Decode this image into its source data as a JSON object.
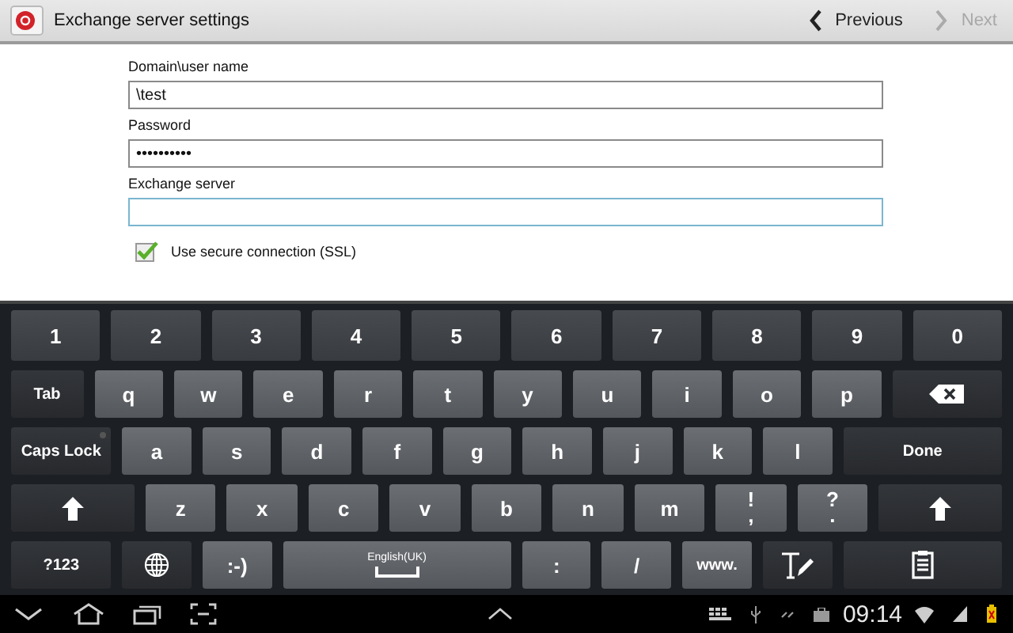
{
  "header": {
    "title": "Exchange server settings",
    "previous": "Previous",
    "next": "Next",
    "next_disabled": true
  },
  "form": {
    "fields": [
      {
        "label": "Domain\\user name",
        "value": "\\test",
        "focused": false
      },
      {
        "label": "Password",
        "value": "••••••••••",
        "focused": false
      },
      {
        "label": "Exchange server",
        "focused": true
      }
    ],
    "checkbox": {
      "label": "Use secure connection (SSL)",
      "checked": true
    }
  },
  "keyboard": {
    "rows": [
      [
        {
          "kind": "num",
          "label": "1"
        },
        {
          "kind": "num",
          "label": "2"
        },
        {
          "kind": "num",
          "label": "3"
        },
        {
          "kind": "num",
          "label": "4"
        },
        {
          "kind": "num",
          "label": "5"
        },
        {
          "kind": "num",
          "label": "6"
        },
        {
          "kind": "num",
          "label": "7"
        },
        {
          "kind": "num",
          "label": "8"
        },
        {
          "kind": "num",
          "label": "9"
        },
        {
          "kind": "num",
          "label": "0"
        }
      ],
      [
        {
          "kind": "tab",
          "label": "Tab"
        },
        {
          "kind": "letter",
          "label": "q"
        },
        {
          "kind": "letter",
          "label": "w"
        },
        {
          "kind": "letter",
          "label": "e"
        },
        {
          "kind": "letter",
          "label": "r"
        },
        {
          "kind": "letter",
          "label": "t"
        },
        {
          "kind": "letter",
          "label": "y"
        },
        {
          "kind": "letter",
          "label": "u"
        },
        {
          "kind": "letter",
          "label": "i"
        },
        {
          "kind": "letter",
          "label": "o"
        },
        {
          "kind": "letter",
          "label": "p"
        },
        {
          "kind": "backspace"
        }
      ],
      [
        {
          "kind": "caps",
          "label": "Caps Lock",
          "on": false
        },
        {
          "kind": "letter",
          "label": "a"
        },
        {
          "kind": "letter",
          "label": "s"
        },
        {
          "kind": "letter",
          "label": "d"
        },
        {
          "kind": "letter",
          "label": "f"
        },
        {
          "kind": "letter",
          "label": "g"
        },
        {
          "kind": "letter",
          "label": "h"
        },
        {
          "kind": "letter",
          "label": "j"
        },
        {
          "kind": "letter",
          "label": "k"
        },
        {
          "kind": "letter",
          "label": "l"
        },
        {
          "kind": "done",
          "label": "Done"
        }
      ],
      [
        {
          "kind": "shift"
        },
        {
          "kind": "letter",
          "label": "z"
        },
        {
          "kind": "letter",
          "label": "x"
        },
        {
          "kind": "letter",
          "label": "c"
        },
        {
          "kind": "letter",
          "label": "v"
        },
        {
          "kind": "letter",
          "label": "b"
        },
        {
          "kind": "letter",
          "label": "n"
        },
        {
          "kind": "letter",
          "label": "m"
        },
        {
          "kind": "punct",
          "label": "!",
          "sub": ","
        },
        {
          "kind": "punct",
          "label": "?",
          "sub": "."
        },
        {
          "kind": "shift"
        }
      ],
      [
        {
          "kind": "symbols",
          "label": "?123"
        },
        {
          "kind": "globe"
        },
        {
          "kind": "letter",
          "label": ":-)"
        },
        {
          "kind": "space",
          "label": "English(UK)"
        },
        {
          "kind": "letter",
          "label": ":"
        },
        {
          "kind": "letter",
          "label": "/"
        },
        {
          "kind": "www",
          "label": "www."
        },
        {
          "kind": "handwriting"
        },
        {
          "kind": "clipboard"
        }
      ]
    ]
  },
  "status_bar": {
    "time": "09:14"
  }
}
